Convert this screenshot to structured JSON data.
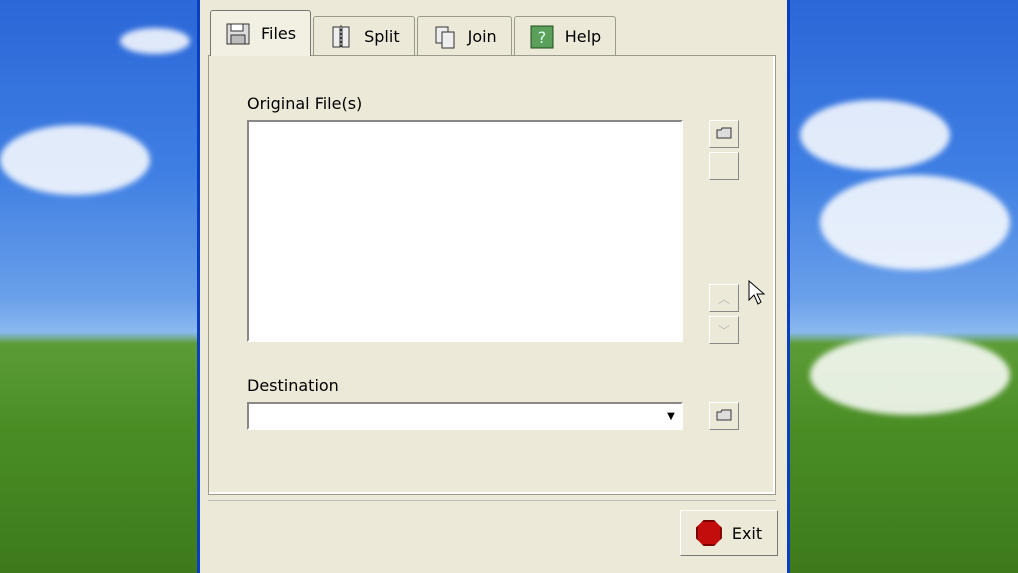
{
  "tabs": [
    {
      "label": "Files",
      "icon": "floppy-disk-icon",
      "active": true
    },
    {
      "label": "Split",
      "icon": "split-icon",
      "active": false
    },
    {
      "label": "Join",
      "icon": "join-icon",
      "active": false
    },
    {
      "label": "Help",
      "icon": "help-icon",
      "active": false
    }
  ],
  "files_panel": {
    "original_label": "Original File(s)",
    "destination_label": "Destination",
    "destination_value": ""
  },
  "footer": {
    "exit_label": "Exit"
  },
  "colors": {
    "window_bg": "#ece9d8",
    "frame_blue": "#0a3fbf",
    "exit_stop_red": "#c30d0d"
  }
}
